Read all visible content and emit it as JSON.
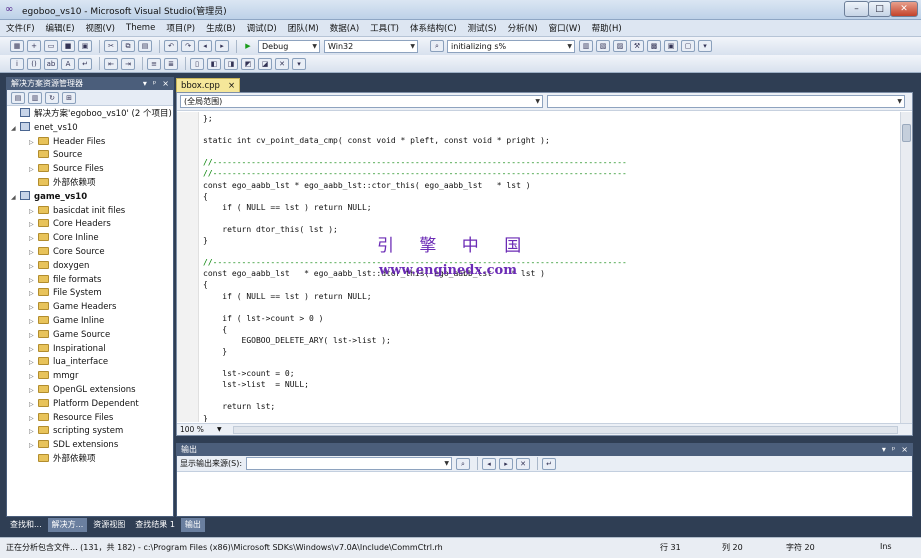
{
  "window": {
    "title": "egoboo_vs10 - Microsoft Visual Studio(管理员)",
    "min": "–",
    "max": "□",
    "close": "✕"
  },
  "menu": [
    "文件(F)",
    "编辑(E)",
    "视图(V)",
    "Theme",
    "项目(P)",
    "生成(B)",
    "调试(D)",
    "团队(M)",
    "数据(A)",
    "工具(T)",
    "体系结构(C)",
    "测试(S)",
    "分析(N)",
    "窗口(W)",
    "帮助(H)"
  ],
  "toolbar": {
    "config": "Debug",
    "platform": "Win32",
    "find": "initializing s%"
  },
  "solution_explorer": {
    "title": "解决方案资源管理器",
    "header_buttons": [
      "▾",
      "ᵖ",
      "×"
    ],
    "items": [
      {
        "label": "解决方案'egoboo_vs10' (2 个项目)",
        "indent": 0,
        "expander": "",
        "icon": "solution-icon",
        "bold": false
      },
      {
        "label": "enet_vs10",
        "indent": 0,
        "expander": "◢",
        "icon": "project-icon",
        "bold": false
      },
      {
        "label": "Header Files",
        "indent": 1,
        "expander": "▷",
        "icon": "folder-icon",
        "bold": false
      },
      {
        "label": "Source",
        "indent": 1,
        "expander": "",
        "icon": "folder-icon",
        "bold": false
      },
      {
        "label": "Source Files",
        "indent": 1,
        "expander": "▷",
        "icon": "folder-icon",
        "bold": false
      },
      {
        "label": "外部依赖项",
        "indent": 1,
        "expander": "",
        "icon": "folder-icon",
        "bold": false
      },
      {
        "label": "game_vs10",
        "indent": 0,
        "expander": "◢",
        "icon": "project-icon",
        "bold": true
      },
      {
        "label": "basicdat init files",
        "indent": 1,
        "expander": "▷",
        "icon": "folder-icon",
        "bold": false
      },
      {
        "label": "Core Headers",
        "indent": 1,
        "expander": "▷",
        "icon": "folder-icon",
        "bold": false
      },
      {
        "label": "Core Inline",
        "indent": 1,
        "expander": "▷",
        "icon": "folder-icon",
        "bold": false
      },
      {
        "label": "Core Source",
        "indent": 1,
        "expander": "▷",
        "icon": "folder-icon",
        "bold": false
      },
      {
        "label": "doxygen",
        "indent": 1,
        "expander": "▷",
        "icon": "folder-icon",
        "bold": false
      },
      {
        "label": "file formats",
        "indent": 1,
        "expander": "▷",
        "icon": "folder-icon",
        "bold": false
      },
      {
        "label": "File System",
        "indent": 1,
        "expander": "▷",
        "icon": "folder-icon",
        "bold": false
      },
      {
        "label": "Game Headers",
        "indent": 1,
        "expander": "▷",
        "icon": "folder-icon",
        "bold": false
      },
      {
        "label": "Game Inline",
        "indent": 1,
        "expander": "▷",
        "icon": "folder-icon",
        "bold": false
      },
      {
        "label": "Game Source",
        "indent": 1,
        "expander": "▷",
        "icon": "folder-icon",
        "bold": false
      },
      {
        "label": "Inspirational",
        "indent": 1,
        "expander": "▷",
        "icon": "folder-icon",
        "bold": false
      },
      {
        "label": "lua_interface",
        "indent": 1,
        "expander": "▷",
        "icon": "folder-icon",
        "bold": false
      },
      {
        "label": "mmgr",
        "indent": 1,
        "expander": "▷",
        "icon": "folder-icon",
        "bold": false
      },
      {
        "label": "OpenGL extensions",
        "indent": 1,
        "expander": "▷",
        "icon": "folder-icon",
        "bold": false
      },
      {
        "label": "Platform Dependent",
        "indent": 1,
        "expander": "▷",
        "icon": "folder-icon",
        "bold": false
      },
      {
        "label": "Resource Files",
        "indent": 1,
        "expander": "▷",
        "icon": "folder-icon",
        "bold": false
      },
      {
        "label": "scripting system",
        "indent": 1,
        "expander": "▷",
        "icon": "folder-icon",
        "bold": false
      },
      {
        "label": "SDL extensions",
        "indent": 1,
        "expander": "▷",
        "icon": "folder-icon",
        "bold": false
      },
      {
        "label": "外部依赖项",
        "indent": 1,
        "expander": "",
        "icon": "folder-icon",
        "bold": false
      }
    ]
  },
  "editor": {
    "tab": "bbox.cpp",
    "tab_close": "×",
    "scope": "(全局范围)",
    "zoom": "100 %",
    "watermark_cn": "引 擎 中 国",
    "watermark_url": "www.enginedx.com",
    "lines": [
      "};",
      "",
      "static int cv_point_data_cmp( const void * pleft, const void * pright );",
      "",
      "//--------------------------------------------------------------------------------------",
      "//--------------------------------------------------------------------------------------",
      "const ego_aabb_lst * ego_aabb_lst::ctor_this( ego_aabb_lst   * lst )",
      "{",
      "    if ( NULL == lst ) return NULL;",
      "",
      "    return dtor_this( lst );",
      "}",
      "",
      "//--------------------------------------------------------------------------------------",
      "const ego_aabb_lst   * ego_aabb_lst::dtor_this( ego_aabb_lst    * lst )",
      "{",
      "    if ( NULL == lst ) return NULL;",
      "",
      "    if ( lst->count > 0 )",
      "    {",
      "        EGOBOO_DELETE_ARY( lst->list );",
      "    }",
      "",
      "    lst->count = 0;",
      "    lst->list  = NULL;",
      "",
      "    return lst;",
      "}"
    ]
  },
  "output": {
    "title": "输出",
    "source_label": "显示输出来源(S):",
    "header_buttons": [
      "▾",
      "ᵖ",
      "×"
    ]
  },
  "bottom_tabs": [
    "查找和...",
    "解决方...",
    "资源视图",
    "查找结果 1",
    "输出"
  ],
  "status": {
    "message": "正在分析包含文件... (131，共 182) - c:\\Program Files (x86)\\Microsoft SDKs\\Windows\\v7.0A\\Include\\CommCtrl.rh",
    "line": "行 31",
    "col": "列 20",
    "char": "字符 20",
    "mode": "Ins"
  },
  "colors": {
    "accent": "#4b5e7b",
    "keyword": "#0000ff",
    "comment": "#008000",
    "watermark": "#6b2bb5"
  }
}
